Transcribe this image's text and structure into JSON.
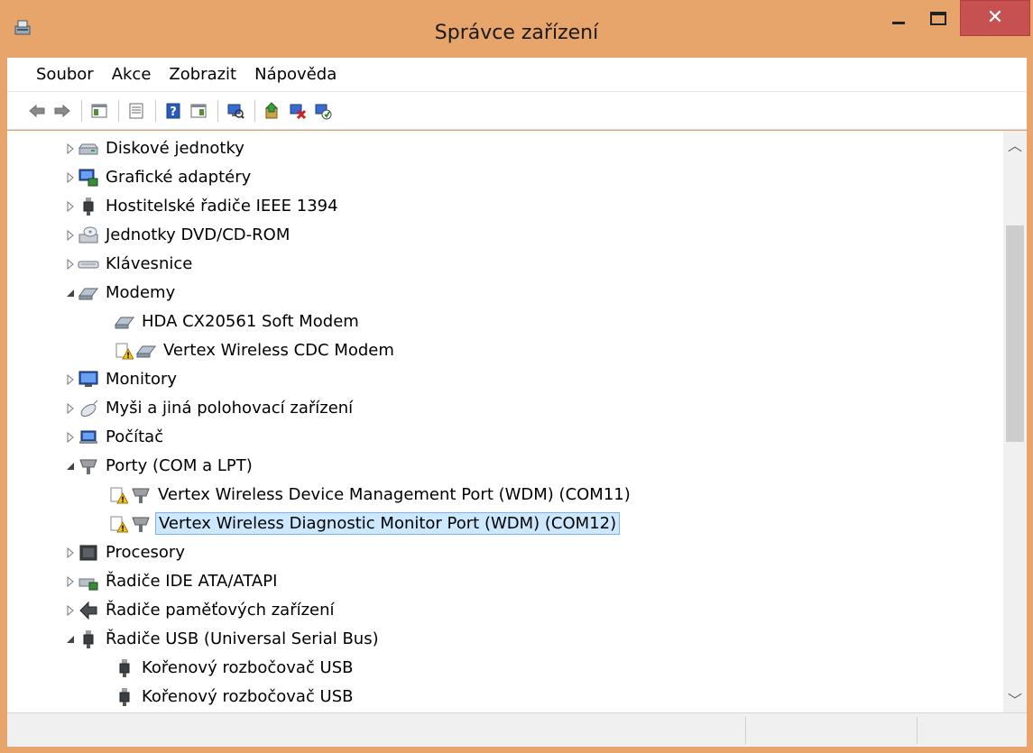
{
  "window": {
    "title": "Správce zařízení",
    "title_bar_color": "#e8a56b",
    "close_button_color": "#c75050"
  },
  "menu": {
    "items": [
      "Soubor",
      "Akce",
      "Zobrazit",
      "Nápověda"
    ]
  },
  "toolbar": {
    "icons": [
      "back-icon",
      "forward-icon",
      "show-hide-tree-icon",
      "properties-icon",
      "help-icon",
      "action-pane-icon",
      "scan-hardware-icon",
      "update-driver-icon",
      "uninstall-icon",
      "enable-device-icon"
    ]
  },
  "tree": {
    "rows": [
      {
        "label": "Diskové jednotky",
        "icon": "disk-drive-icon",
        "state": "collapsed",
        "level": 0
      },
      {
        "label": "Grafické adaptéry",
        "icon": "display-adapter-icon",
        "state": "collapsed",
        "level": 0
      },
      {
        "label": "Hostitelské řadiče IEEE 1394",
        "icon": "ieee1394-controller-icon",
        "state": "collapsed",
        "level": 0
      },
      {
        "label": "Jednotky DVD/CD-ROM",
        "icon": "dvd-drive-icon",
        "state": "collapsed",
        "level": 0
      },
      {
        "label": "Klávesnice",
        "icon": "keyboard-icon",
        "state": "collapsed",
        "level": 0
      },
      {
        "label": "Modemy",
        "icon": "modem-icon",
        "state": "expanded",
        "level": 0
      },
      {
        "label": "HDA CX20561 Soft Modem",
        "icon": "modem-icon",
        "state": "leaf",
        "level": 1
      },
      {
        "label": "Vertex Wireless CDC Modem",
        "icon": "modem-icon",
        "state": "leaf",
        "level": 1,
        "warning": true
      },
      {
        "label": "Monitory",
        "icon": "monitor-icon",
        "state": "collapsed",
        "level": 0
      },
      {
        "label": "Myši a jiná polohovací zařízení",
        "icon": "mouse-icon",
        "state": "collapsed",
        "level": 0
      },
      {
        "label": "Počítač",
        "icon": "computer-icon",
        "state": "collapsed",
        "level": 0
      },
      {
        "label": "Porty (COM a LPT)",
        "icon": "port-icon",
        "state": "expanded",
        "level": 0
      },
      {
        "label": "Vertex Wireless Device Management Port (WDM) (COM11)",
        "icon": "port-icon",
        "state": "leaf",
        "level": 1,
        "warning": true
      },
      {
        "label": "Vertex Wireless Diagnostic Monitor Port (WDM) (COM12)",
        "icon": "port-icon",
        "state": "leaf",
        "level": 1,
        "warning": true,
        "selected": true
      },
      {
        "label": "Procesory",
        "icon": "processor-icon",
        "state": "collapsed",
        "level": 0
      },
      {
        "label": "Řadiče IDE ATA/ATAPI",
        "icon": "ide-controller-icon",
        "state": "collapsed",
        "level": 0
      },
      {
        "label": "Řadiče paměťových zařízení",
        "icon": "storage-controller-icon",
        "state": "collapsed",
        "level": 0
      },
      {
        "label": "Řadiče USB (Universal Serial Bus)",
        "icon": "usb-controller-icon",
        "state": "expanded",
        "level": 0
      },
      {
        "label": "Kořenový rozbočovač USB",
        "icon": "usb-device-icon",
        "state": "leaf",
        "level": 1
      },
      {
        "label": "Kořenový rozbočovač USB",
        "icon": "usb-device-icon",
        "state": "leaf",
        "level": 1
      }
    ]
  },
  "colors": {
    "selection_bg": "#cce8ff",
    "selection_border": "#7eb4ea"
  }
}
